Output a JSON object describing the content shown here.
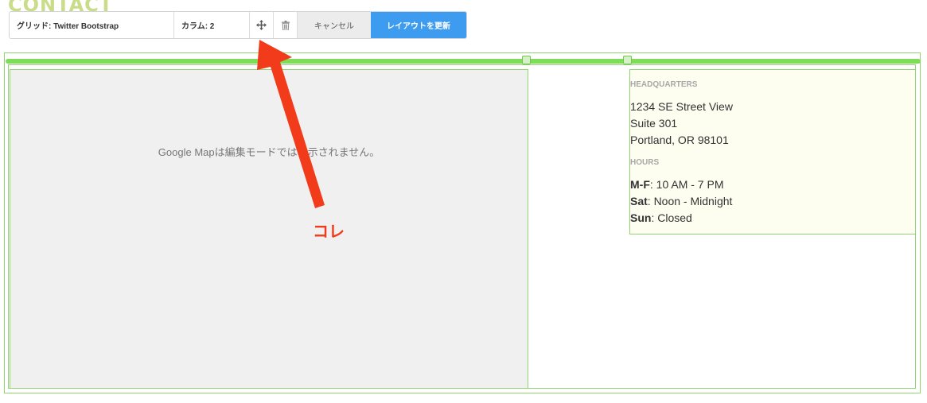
{
  "page": {
    "heading": "CONTACT"
  },
  "toolbar": {
    "grid_label": "グリッド: Twitter Bootstrap",
    "columns_label": "カラム: 2",
    "move_icon": "move-arrows-icon",
    "delete_icon": "trash-icon",
    "cancel_label": "キャンセル",
    "update_label": "レイアウトを更新",
    "update_color": "#3d9bf0"
  },
  "map": {
    "placeholder": "Google Mapは編集モードでは表示されません。"
  },
  "info": {
    "hq_heading": "HEADQUARTERS",
    "address": [
      "1234 SE Street View",
      "Suite 301",
      "Portland, OR 98101"
    ],
    "hours_heading": "HOURS",
    "hours": [
      {
        "day": "M-F",
        "time": ": 10 AM - 7 PM"
      },
      {
        "day": "Sat",
        "time": ": Noon - Midnight"
      },
      {
        "day": "Sun",
        "time": ": Closed"
      }
    ]
  },
  "annotation": {
    "label": "コレ",
    "color": "#f13b1a"
  },
  "colors": {
    "guide_green": "#7fdc58",
    "map_bg": "#f0f0f0",
    "info_bg": "#fdfdf0"
  }
}
